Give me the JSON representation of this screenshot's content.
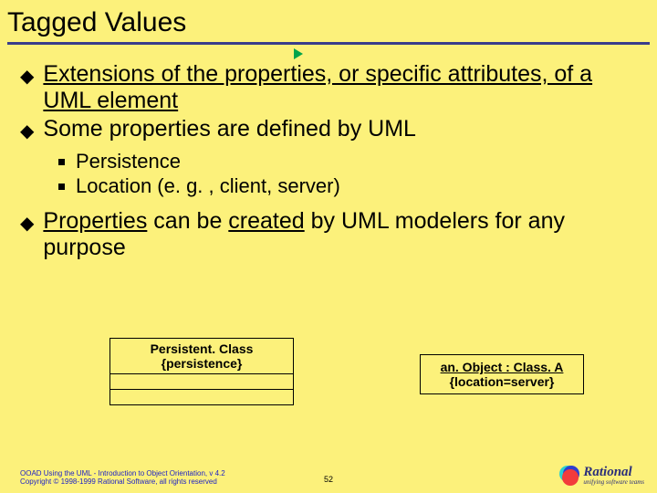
{
  "title": "Tagged Values",
  "bullets": {
    "b1": "Extensions of the properties, or specific attributes, of a UML element",
    "b2": "Some properties are defined by UML",
    "sub1": "Persistence",
    "sub2": "Location (e. g. , client, server)",
    "b3_pre": "Properties",
    "b3_mid": " can be ",
    "b3_created": "created",
    "b3_post": " by UML modelers for any purpose"
  },
  "uml": {
    "class_name": "Persistent. Class",
    "class_tag": "{persistence}",
    "obj_name": "an. Object : Class. A",
    "obj_tag": "{location=server}"
  },
  "footer": {
    "line1": "OOAD Using the UML - Introduction to Object Orientation, v 4.2",
    "line2": "Copyright © 1998-1999 Rational Software, all rights reserved",
    "page": "52",
    "logo_name": "Rational",
    "logo_tag": "unifying software teams"
  }
}
